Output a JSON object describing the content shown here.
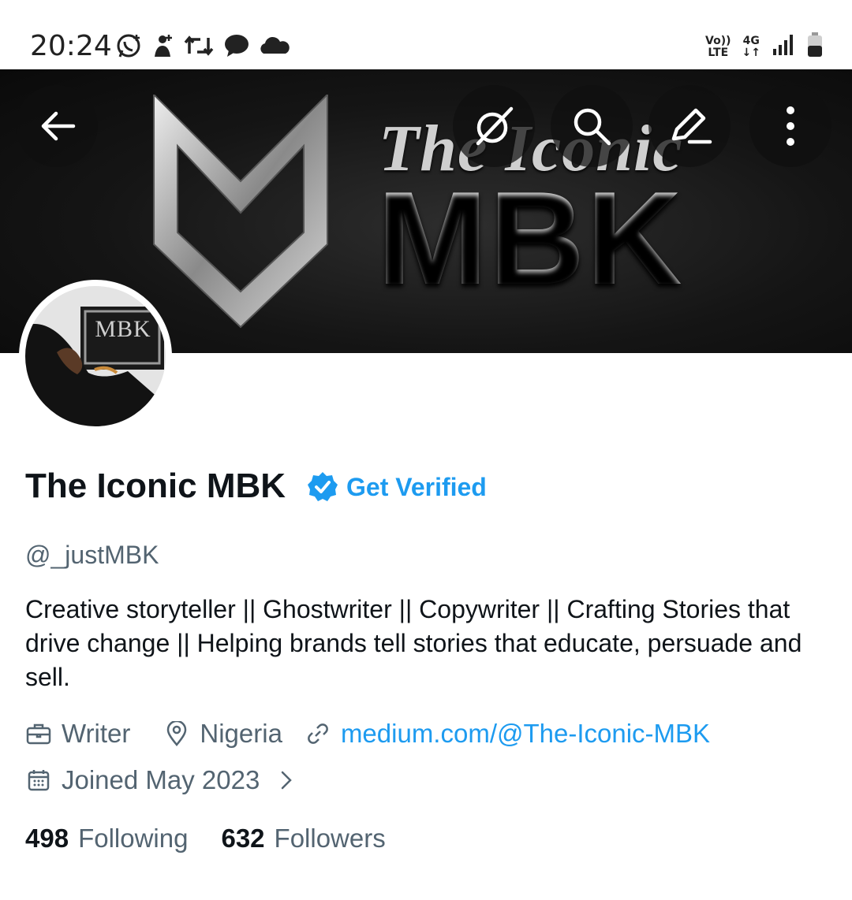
{
  "status_bar": {
    "time": "20:24",
    "volte": "Vo))",
    "lte": "LTE",
    "network": "4G",
    "icons": [
      "whatsapp-icon",
      "user-plus-icon",
      "retweet-icon",
      "chat-bubble-icon",
      "cloud-icon",
      "signal-icon",
      "battery-icon"
    ]
  },
  "banner": {
    "script_text": "The Iconic",
    "big_text": "MBK"
  },
  "header_buttons": [
    "back-arrow-icon",
    "grok-icon",
    "search-icon",
    "edit-icon",
    "more-vertical-icon"
  ],
  "avatar": {
    "frame_text": "MBK"
  },
  "profile": {
    "name": "The Iconic MBK",
    "get_verified": "Get Verified",
    "handle": "@_justMBK",
    "bio": "Creative storyteller || Ghostwriter || Copywriter || Crafting Stories that drive change || Helping brands tell stories that educate, persuade and sell.",
    "profession": "Writer",
    "location": "Nigeria",
    "website": "medium.com/@The-Iconic-MBK",
    "joined": "Joined May 2023",
    "following_count": "498",
    "following_label": "Following",
    "followers_count": "632",
    "followers_label": "Followers"
  },
  "colors": {
    "accent": "#1d9bf0",
    "secondary_text": "#536471",
    "primary_text": "#0f1419"
  }
}
